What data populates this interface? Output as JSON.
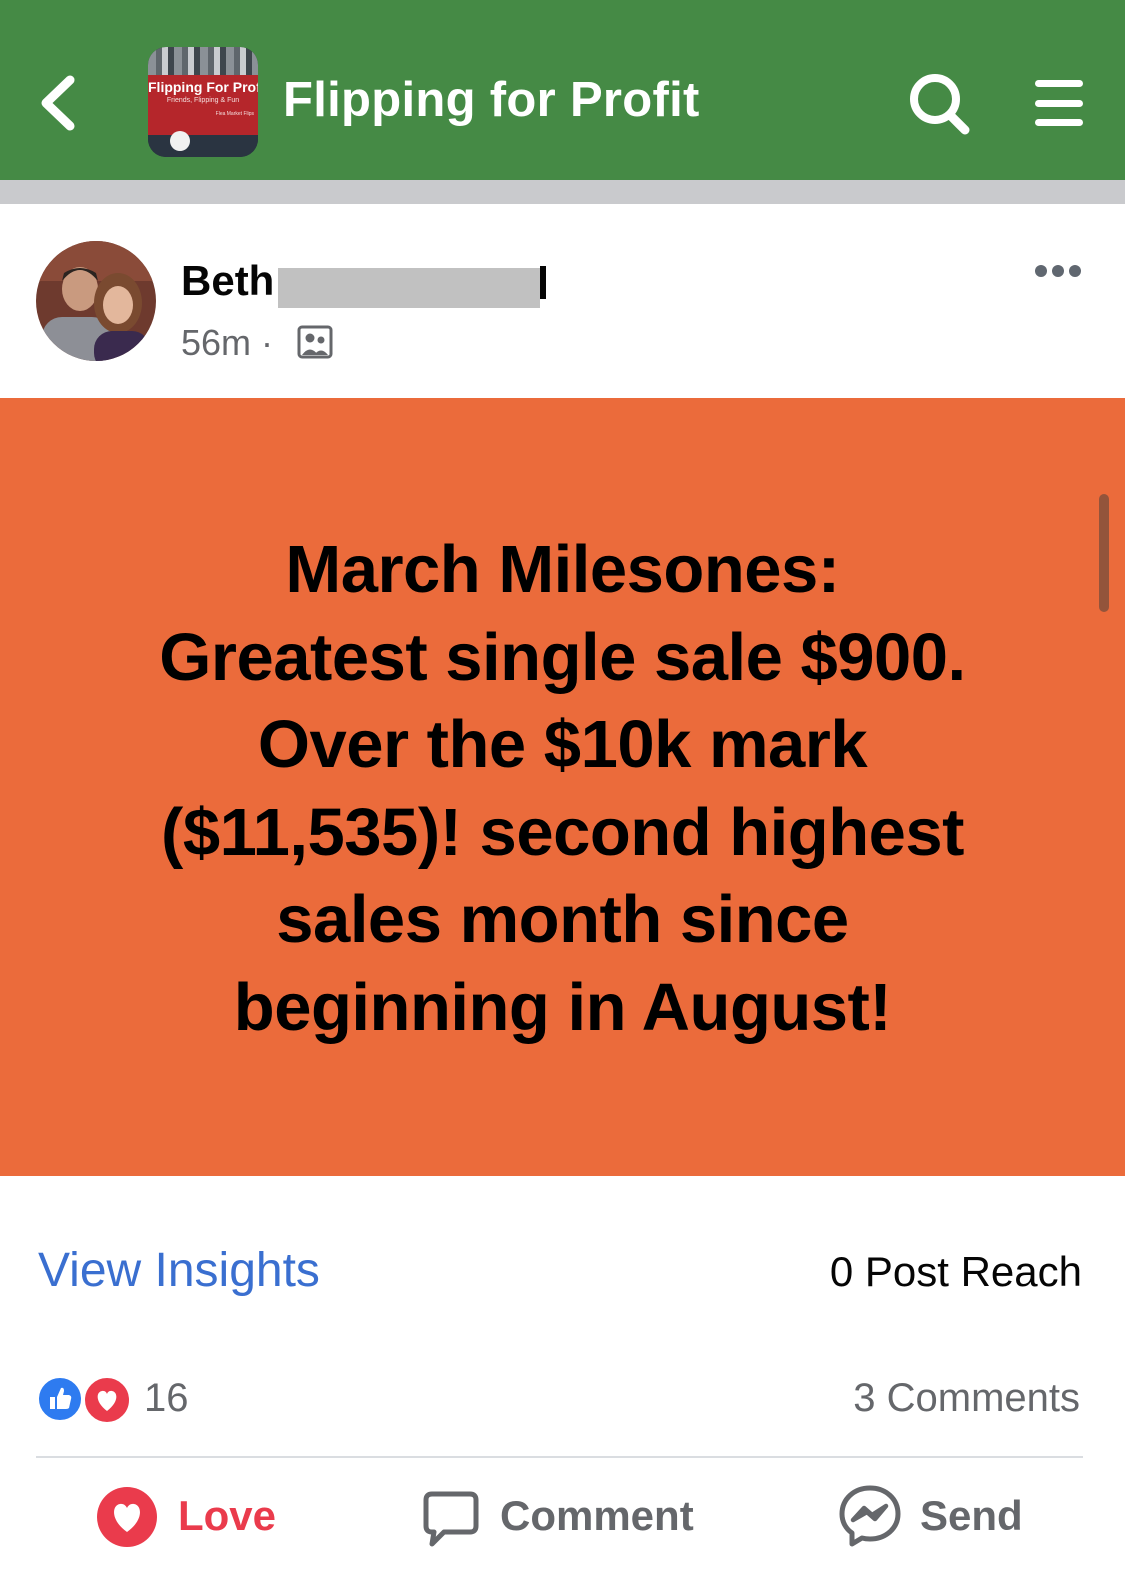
{
  "header": {
    "title": "Flipping for Profit",
    "thumbnail": {
      "title": "Flipping For Profit",
      "subtitle": "Friends, Flipping & Fun",
      "subtitle2": "Flea Market Flips"
    },
    "icons": {
      "back": "chevron-left-icon",
      "search": "search-icon",
      "menu": "hamburger-menu-icon"
    },
    "bar_color": "#458a45"
  },
  "post": {
    "author": "Beth",
    "time": "56m",
    "separator": "·",
    "privacy_icon": "members-group-icon",
    "more_icon": "ellipsis-icon",
    "background_color": "#eb6b3b",
    "text_lines": [
      "March Milesones:",
      "Greatest single sale $900.",
      "Over the $10k mark",
      "($11,535)! second highest",
      "sales month since",
      "beginning in August!"
    ]
  },
  "insights": {
    "link_label": "View Insights",
    "reach_label": "0 Post Reach"
  },
  "reactions": {
    "count": "16",
    "types": [
      "like",
      "love"
    ],
    "comments_label": "3 Comments"
  },
  "actions": {
    "love": "Love",
    "comment": "Comment",
    "send": "Send",
    "love_color": "#ea3b4c"
  }
}
